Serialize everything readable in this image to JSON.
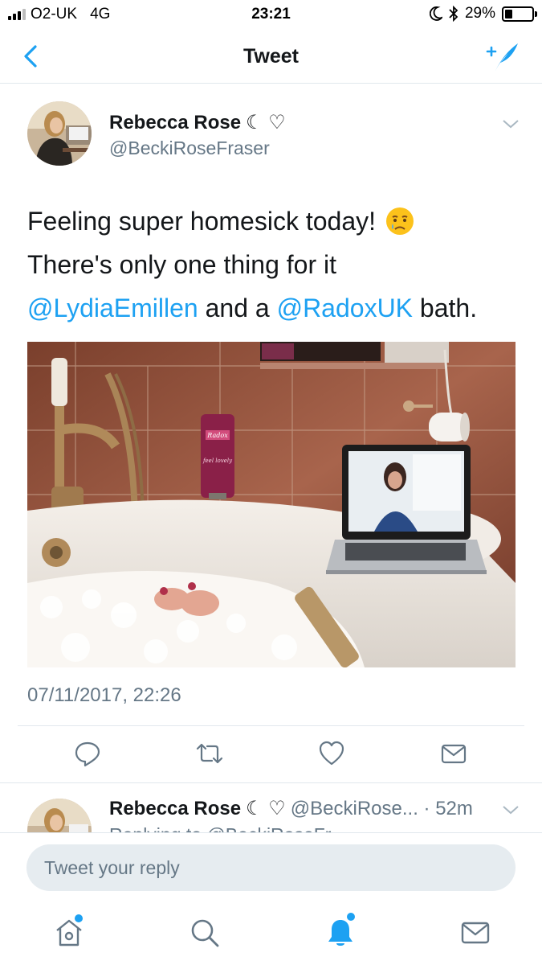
{
  "status_bar": {
    "carrier": "O2-UK",
    "network": "4G",
    "time": "23:21",
    "battery_percent": "29%",
    "battery_level": 0.29,
    "icons": [
      "signal-icon",
      "moon-icon",
      "bluetooth-icon",
      "battery-icon"
    ]
  },
  "nav": {
    "title": "Tweet",
    "back_icon": "chevron-left-icon",
    "compose_icon": "compose-tweet-icon"
  },
  "tweet": {
    "author_name": "Rebecca Rose",
    "author_handle": "@BeckiRoseFraser",
    "name_emoji": "☾ ♡",
    "text_line1": "Feeling super homesick today!",
    "emoji": "crying-face-emoji",
    "text_line2": "There's only one thing for it",
    "mention1": "@LydiaEmillen",
    "text_mid": " and a ",
    "mention2": "@RadoxUK",
    "text_end": " bath.",
    "timestamp": "07/11/2017, 22:26",
    "photo_brand": "Radox",
    "photo_product": "feel lovely"
  },
  "actions": [
    "reply-icon",
    "retweet-icon",
    "like-icon",
    "direct-message-icon"
  ],
  "reply": {
    "author_name": "Rebecca Rose",
    "name_emoji": "☾ ♡",
    "handle_time": "@BeckiRose... · 52m",
    "peek_text": "Replying to @BeckiRoseFr..."
  },
  "composer": {
    "placeholder": "Tweet your reply"
  },
  "tab_bar": [
    "home-icon",
    "search-icon",
    "notifications-icon",
    "messages-icon"
  ],
  "colors": {
    "accent": "#1da1f2",
    "secondary_text": "#657786",
    "divider": "#e1e8ed"
  }
}
